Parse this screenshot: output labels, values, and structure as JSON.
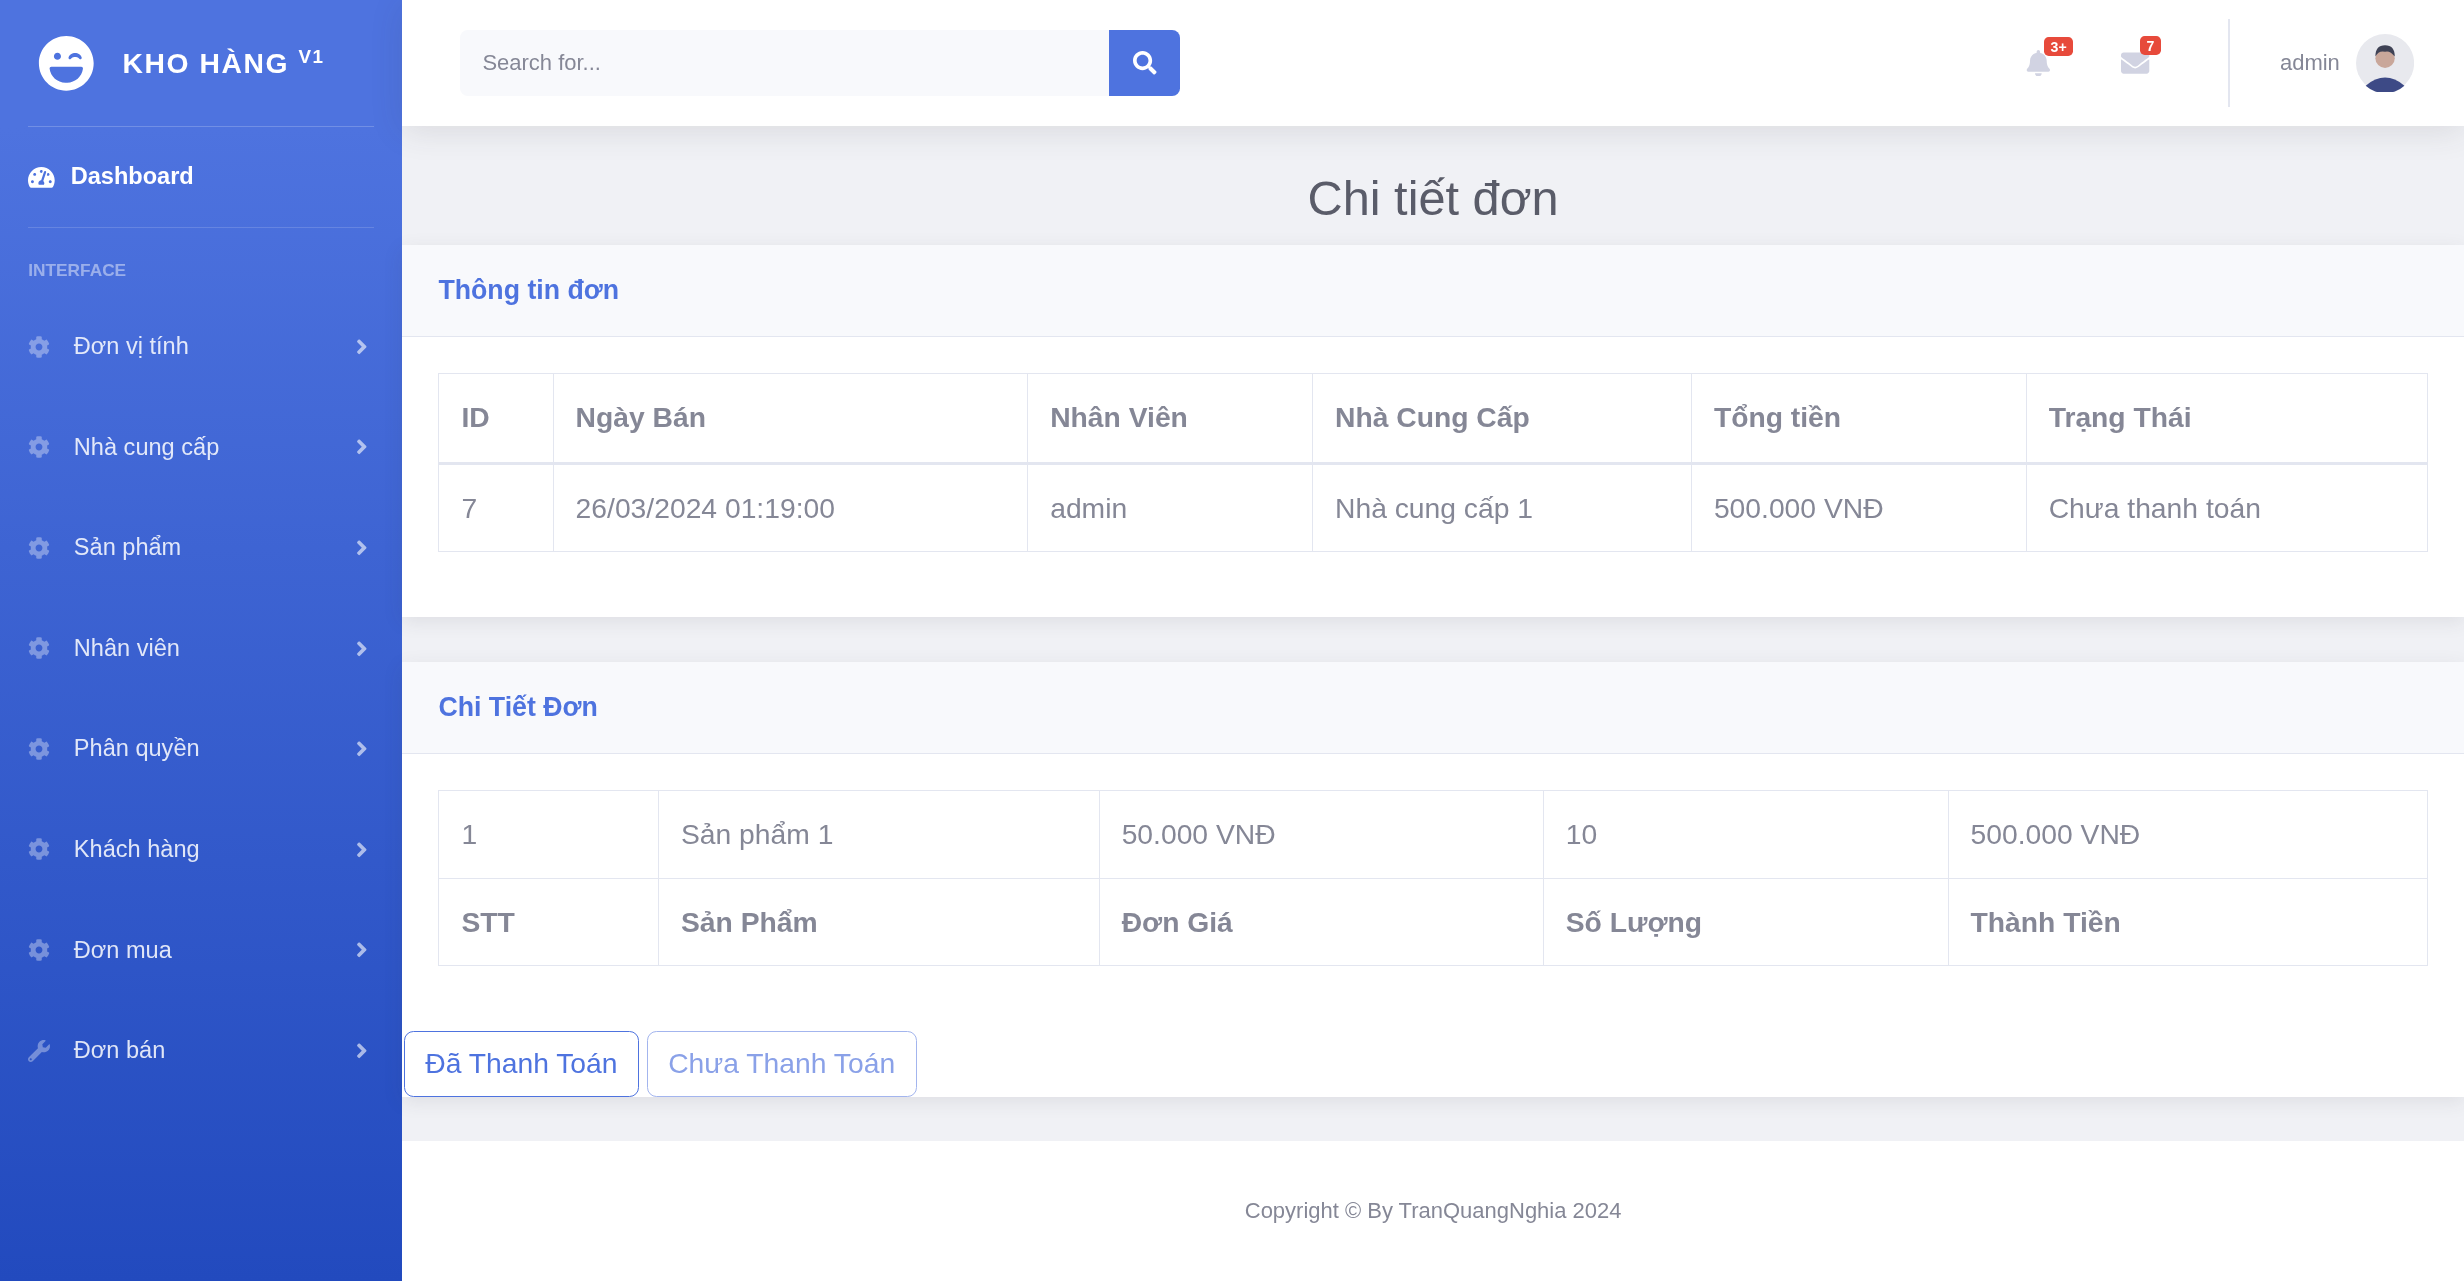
{
  "sidebar": {
    "brand": {
      "name": "KHO HÀNG",
      "version": "V1"
    },
    "dashboard": {
      "label": "Dashboard"
    },
    "section_heading": "INTERFACE",
    "items": [
      {
        "label": "Đơn vị tính",
        "kind": "gear"
      },
      {
        "label": "Nhà cung cấp",
        "kind": "gear"
      },
      {
        "label": "Sản phẩm",
        "kind": "gear"
      },
      {
        "label": "Nhân viên",
        "kind": "gear"
      },
      {
        "label": "Phân quyền",
        "kind": "gear"
      },
      {
        "label": "Khách hàng",
        "kind": "gear"
      },
      {
        "label": "Đơn mua",
        "kind": "gear"
      },
      {
        "label": "Đơn bán",
        "kind": "wrench"
      }
    ]
  },
  "topbar": {
    "search": {
      "placeholder": "Search for..."
    },
    "alerts": [
      {
        "kind": "bell",
        "count": "3+"
      },
      {
        "kind": "envelope",
        "count": "7"
      }
    ],
    "user": {
      "name": "admin"
    }
  },
  "page_title": "Chi tiết đơn",
  "order_info": {
    "title": "Thông tin đơn",
    "columns": [
      "ID",
      "Ngày Bán",
      "Nhân Viên",
      "Nhà Cung Cấp",
      "Tổng tiền",
      "Trạng Thái"
    ],
    "rows": [
      [
        "7",
        "26/03/2024 01:19:00",
        "admin",
        "Nhà cung cấp 1",
        "500.000 VNĐ",
        "Chưa thanh toán"
      ]
    ]
  },
  "order_details": {
    "title": "Chi Tiết Đơn",
    "rows": [
      {
        "kind": "data",
        "cells": [
          "1",
          "Sản phẩm 1",
          "50.000 VNĐ",
          "10",
          "500.000 VNĐ"
        ]
      },
      {
        "kind": "heading",
        "cells": [
          "STT",
          "Sản Phẩm",
          "Đơn Giá",
          "Số Lượng",
          "Thành Tiền"
        ]
      }
    ]
  },
  "buttons": [
    {
      "label": "Đã Thanh Toán",
      "disabled": false
    },
    {
      "label": "Chưa Thanh Toán",
      "disabled": true
    }
  ],
  "footer": "Copyright © By TranQuangNghia 2024"
}
